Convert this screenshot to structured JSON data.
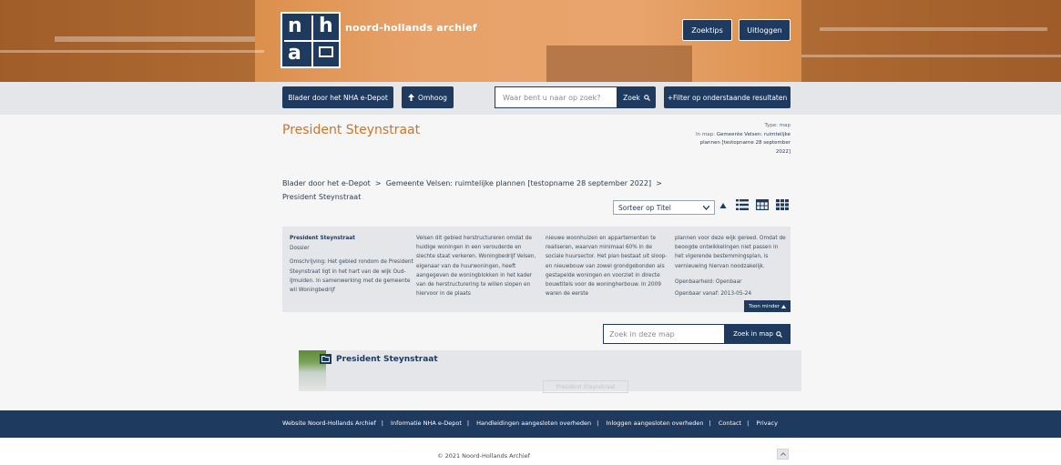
{
  "header": {
    "logo_letters": [
      "n",
      "h",
      "a"
    ],
    "brand_name": "noord-hollands archief",
    "zoektips_label": "Zoektips",
    "uitloggen_label": "Uitloggen"
  },
  "toolbar": {
    "browse_label": "Blader door het NHA e-Depot",
    "up_label": "Omhoog",
    "search_placeholder": "Waar bent u naar op zoek?",
    "search_button_label": "Zoek",
    "filter_label": "+Filter op onderstaande resultaten"
  },
  "page": {
    "title": "President Steynstraat",
    "meta_type": "Type: map",
    "meta_in_map_prefix": "In map: ",
    "meta_in_map_value": "Gemeente Velsen: ruimtelijke plannen [testopname 28 september 2022]",
    "breadcrumb": {
      "item1": "Blader door het e-Depot",
      "sep1": ">",
      "item2": "Gemeente Velsen: ruimtelijke plannen [testopname 28 september 2022]",
      "sep2": ">",
      "item3": "President Steynstraat"
    },
    "sort": {
      "selected": "Sorteer op Titel",
      "direction_icon": "sort-ascending-icon"
    },
    "view_icons": [
      "list-view-icon",
      "table-view-icon",
      "grid-view-icon"
    ]
  },
  "description": {
    "name": "President Steynstraat",
    "kind": "Dossier",
    "omschrijving_label": "Omschrijving: ",
    "omschrijving_start": "Het gebied rondom de President Steynstraat ligt in het hart van de wijk Oud-IJmuiden. In samenwerking met de gemeente wil Woningbedrijf",
    "col2": "Velsen dit gebied herstructureren omdat de huidige woningen in een verouderde en slechte staat verkeren. Woningbedrijf Velsen, eigenaar van de huurwoningen, heeft aangegeven de woningblokken in het kader van de herstructurering te willen slopen en hiervoor in de plaats",
    "col3": "nieuwe woonhuizen en appartementen te realiseren, waarvan minimaal 60% in de sociale huursector. Het plan bestaat uit sloop- en nieuwbouw van zowel grondgebonden als gestapelde woningen en voorziet in directe bouwtitels voor de woningherbouw. In 2009 waren de eerste",
    "col4": "plannen voor deze wijk gereed. Omdat de beoogde ontwikkelingen niet passen in het vigerende bestemmingsplan, is vernieuwing hiervan noodzakelijk.",
    "openbaarheid": "Openbaarheid: Openbaar",
    "openbaar_vanaf": "Openbaar vanaf: 2013-05-24",
    "toon_minder": "Toon minder"
  },
  "map_search": {
    "placeholder": "Zoek in deze map",
    "button_label": "Zoek in map"
  },
  "results": [
    {
      "title": "President Steynstraat",
      "thumbnail_caption": "President Steynstraat"
    }
  ],
  "footer": {
    "links": [
      "Website Noord-Hollands Archief",
      "Informatie NHA e-Depot",
      "Handleidingen aangesloten overheden",
      "Inloggen aangesloten overheden",
      "Contact",
      "Privacy"
    ],
    "separator": "|",
    "copyright": "© 2021 Noord-Hollands Archief"
  },
  "colors": {
    "navy": "#1f3a5f",
    "accent_orange": "#c8762e",
    "panel_gray": "#e4e6e9"
  }
}
